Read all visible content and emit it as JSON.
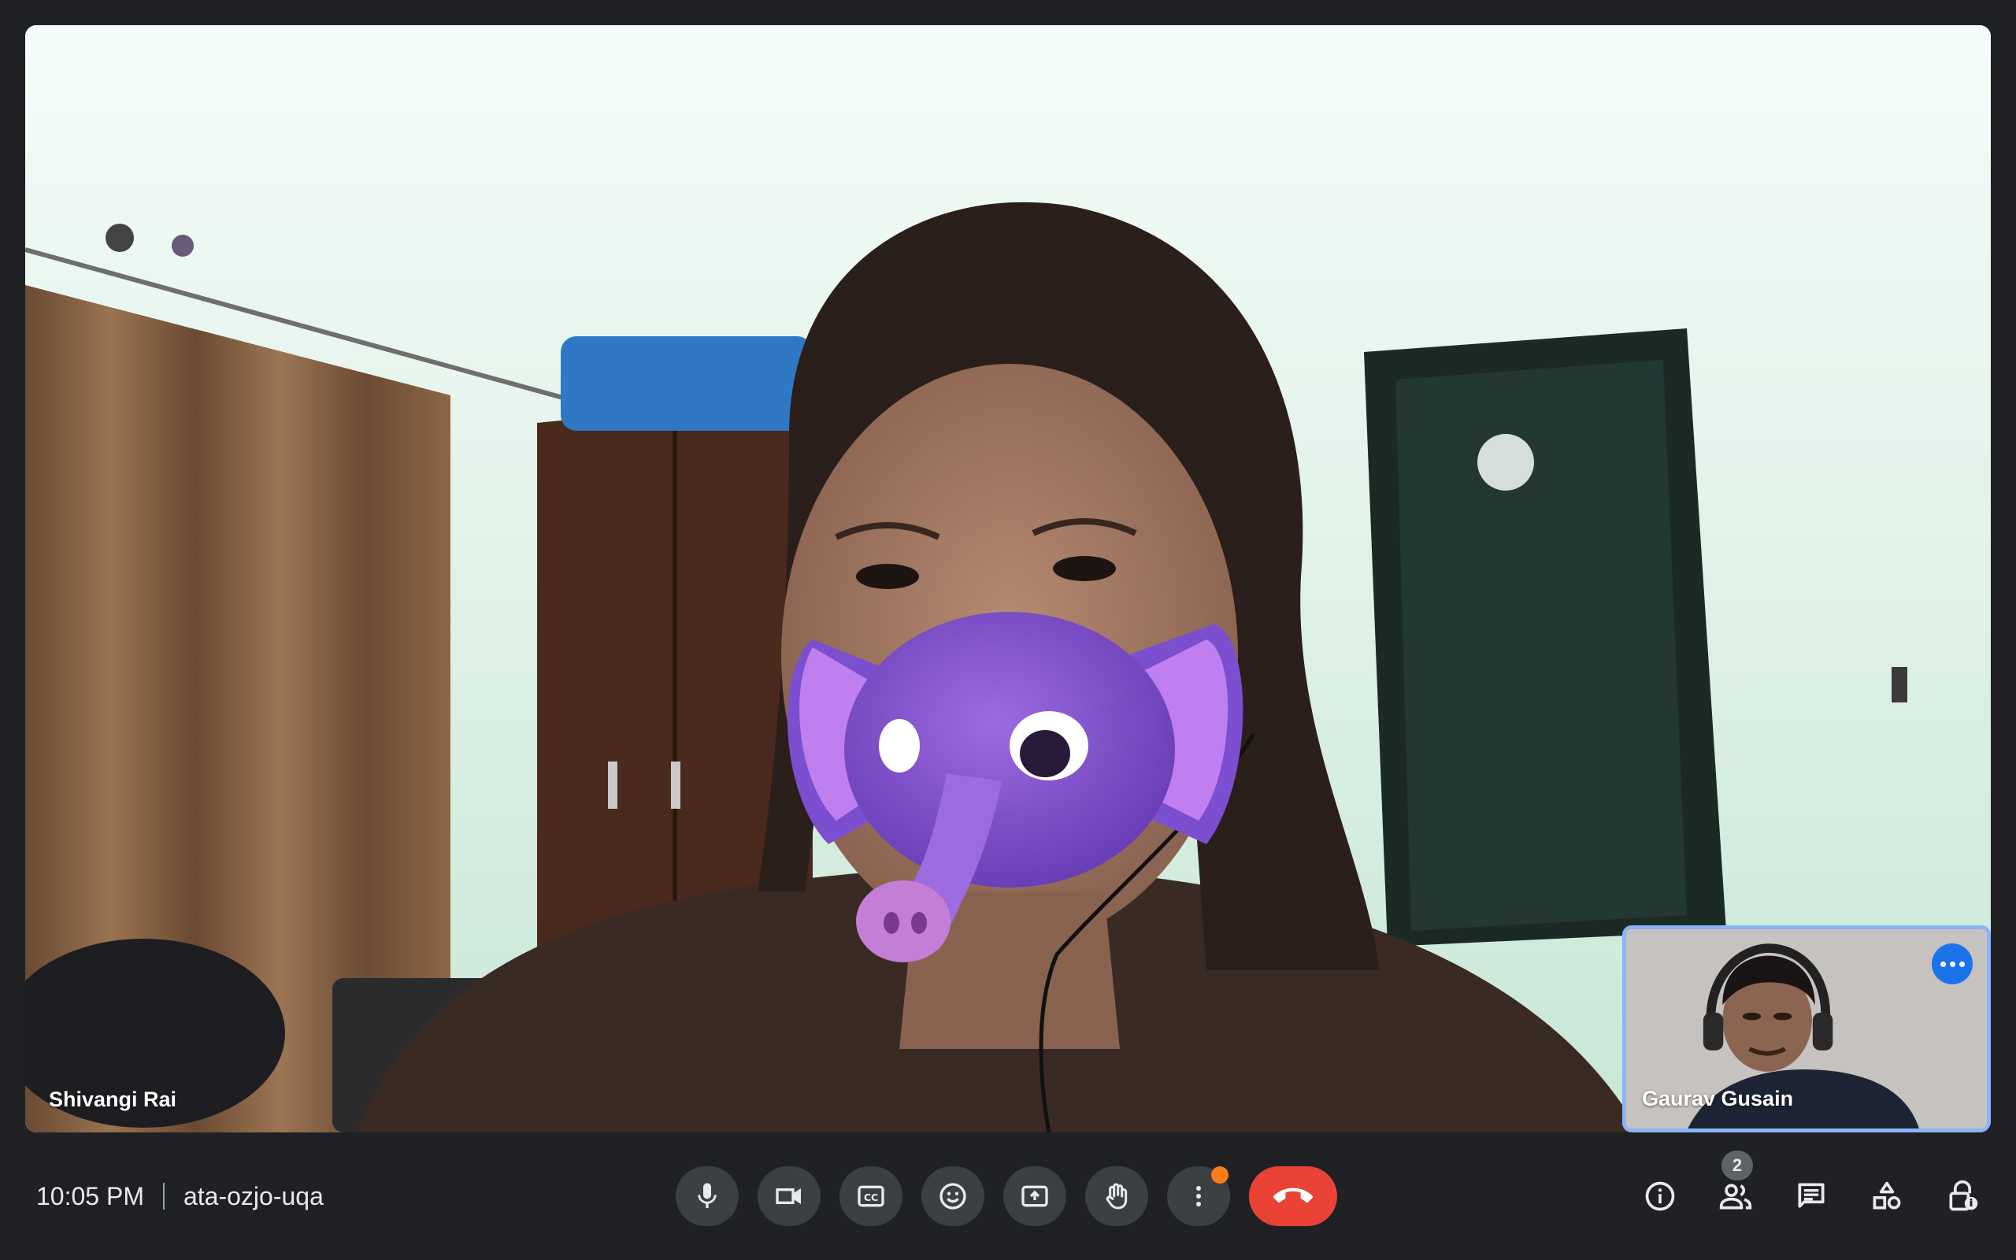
{
  "main_tile": {
    "participant_name": "Shivangi Rai"
  },
  "self_tile": {
    "participant_name": "Gaurav Gusain",
    "more_options_icon": "more-horiz-icon"
  },
  "meeting": {
    "time": "10:05 PM",
    "code": "ata-ozjo-uqa"
  },
  "controls": [
    {
      "name": "microphone",
      "icon": "mic-icon"
    },
    {
      "name": "camera",
      "icon": "videocam-icon"
    },
    {
      "name": "captions",
      "icon": "closed-caption-icon"
    },
    {
      "name": "reactions",
      "icon": "emoji-icon"
    },
    {
      "name": "present",
      "icon": "present-screen-icon"
    },
    {
      "name": "raise-hand",
      "icon": "hand-icon"
    },
    {
      "name": "more-options",
      "icon": "more-vert-icon",
      "notification": true
    },
    {
      "name": "leave-call",
      "icon": "call-end-icon"
    }
  ],
  "side_panel_buttons": {
    "participants_count": "2"
  },
  "colors": {
    "background": "#202124",
    "control": "#3c4043",
    "hangup": "#ea4335",
    "self_tile_border": "#8ab4f8",
    "more_button": "#1a73e8",
    "notification_dot": "#fa7b17"
  }
}
